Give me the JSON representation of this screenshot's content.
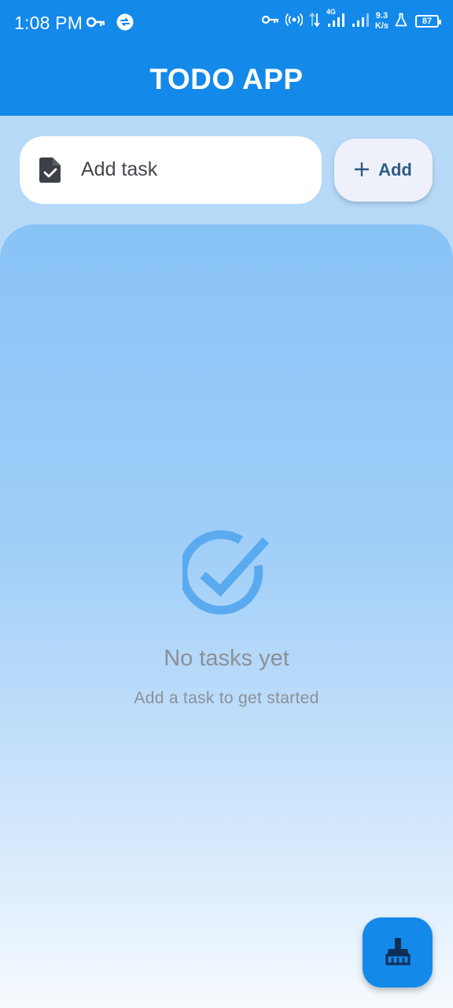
{
  "status_bar": {
    "time": "1:08 PM",
    "net_speed_value": "9.3",
    "net_speed_unit": "K/s",
    "network_type": "4G",
    "battery": "87",
    "icons": [
      "vpn-key-icon",
      "sync-icon",
      "vpn-key-icon",
      "hotspot-icon",
      "data-arrows-icon",
      "signal-icon",
      "signal-icon",
      "lab-flask-icon",
      "battery-icon"
    ]
  },
  "app_bar": {
    "title": "TODO APP"
  },
  "task_input": {
    "placeholder": "Add task",
    "value": "",
    "icon": "document-check-icon"
  },
  "add_button": {
    "icon": "plus-icon",
    "label": "Add"
  },
  "empty_state": {
    "icon": "check-circle-icon",
    "title": "No tasks yet",
    "subtitle": "Add a task to get started"
  },
  "fab": {
    "icon": "broom-clean-icon"
  },
  "colors": {
    "primary": "#1389ea",
    "background": "#b6d9f8",
    "add_button_bg": "#eff1fa",
    "add_button_text": "#2f5a86",
    "empty_icon": "#5aaaf0",
    "muted_text": "#8c9096"
  }
}
